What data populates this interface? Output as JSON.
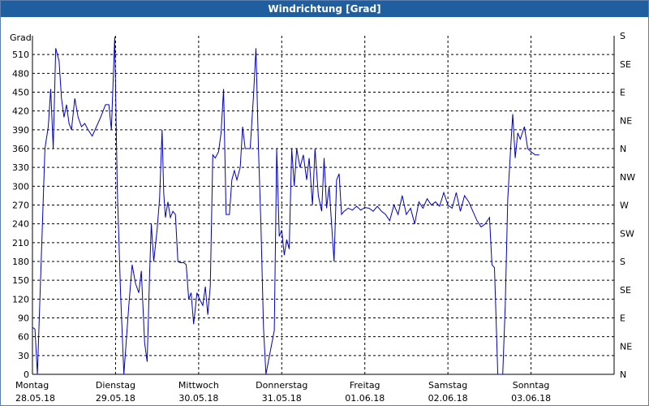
{
  "window": {
    "title": "Windrichtung [Grad]"
  },
  "chart_data": {
    "type": "line",
    "title": "Windrichtung [Grad]",
    "ylabel": "Grad",
    "ylim": [
      0,
      540
    ],
    "y_ticks": [
      0,
      30,
      60,
      90,
      120,
      150,
      180,
      210,
      240,
      270,
      300,
      330,
      360,
      390,
      420,
      450,
      480,
      510
    ],
    "y_tick_labels": [
      "0",
      "30",
      "60",
      "90",
      "120",
      "150",
      "180",
      "210",
      "240",
      "270",
      "300",
      "330",
      "360",
      "390",
      "420",
      "450",
      "480",
      "510"
    ],
    "right_axis_labels": [
      "N",
      "NE",
      "E",
      "SE",
      "S",
      "SW",
      "W",
      "NW",
      "N",
      "NE",
      "E",
      "SE",
      "S"
    ],
    "x_day_labels": [
      {
        "day": "Montag",
        "date": "28.05.18"
      },
      {
        "day": "Dienstag",
        "date": "29.05.18"
      },
      {
        "day": "Mittwoch",
        "date": "30.05.18"
      },
      {
        "day": "Donnerstag",
        "date": "31.05.18"
      },
      {
        "day": "Freitag",
        "date": "01.06.18"
      },
      {
        "day": "Samstag",
        "date": "02.06.18"
      },
      {
        "day": "Sonntag",
        "date": "03.06.18"
      }
    ],
    "xlim_days": [
      0,
      7
    ],
    "grid": true,
    "series": [
      {
        "color": "#0000c0",
        "points": [
          [
            0.0,
            75
          ],
          [
            0.03,
            72
          ],
          [
            0.06,
            0
          ],
          [
            0.15,
            360
          ],
          [
            0.19,
            395
          ],
          [
            0.22,
            455
          ],
          [
            0.25,
            360
          ],
          [
            0.28,
            520
          ],
          [
            0.32,
            500
          ],
          [
            0.35,
            440
          ],
          [
            0.38,
            410
          ],
          [
            0.41,
            430
          ],
          [
            0.44,
            400
          ],
          [
            0.47,
            390
          ],
          [
            0.51,
            440
          ],
          [
            0.55,
            410
          ],
          [
            0.59,
            395
          ],
          [
            0.63,
            400
          ],
          [
            0.67,
            390
          ],
          [
            0.72,
            380
          ],
          [
            0.77,
            395
          ],
          [
            0.82,
            410
          ],
          [
            0.88,
            430
          ],
          [
            0.92,
            430
          ],
          [
            0.95,
            390
          ],
          [
            0.99,
            538
          ],
          [
            1.02,
            300
          ],
          [
            1.06,
            130
          ],
          [
            1.1,
            0
          ],
          [
            1.16,
            110
          ],
          [
            1.2,
            175
          ],
          [
            1.24,
            145
          ],
          [
            1.28,
            130
          ],
          [
            1.31,
            165
          ],
          [
            1.35,
            50
          ],
          [
            1.38,
            20
          ],
          [
            1.41,
            160
          ],
          [
            1.43,
            240
          ],
          [
            1.46,
            180
          ],
          [
            1.5,
            230
          ],
          [
            1.53,
            280
          ],
          [
            1.56,
            390
          ],
          [
            1.58,
            290
          ],
          [
            1.6,
            250
          ],
          [
            1.63,
            275
          ],
          [
            1.66,
            250
          ],
          [
            1.69,
            260
          ],
          [
            1.72,
            255
          ],
          [
            1.75,
            180
          ],
          [
            1.78,
            178
          ],
          [
            1.82,
            178
          ],
          [
            1.85,
            175
          ],
          [
            1.88,
            120
          ],
          [
            1.91,
            130
          ],
          [
            1.94,
            80
          ],
          [
            1.98,
            130
          ],
          [
            2.01,
            120
          ],
          [
            2.05,
            110
          ],
          [
            2.08,
            140
          ],
          [
            2.11,
            95
          ],
          [
            2.14,
            140
          ],
          [
            2.17,
            350
          ],
          [
            2.2,
            345
          ],
          [
            2.24,
            355
          ],
          [
            2.27,
            385
          ],
          [
            2.3,
            455
          ],
          [
            2.33,
            255
          ],
          [
            2.37,
            255
          ],
          [
            2.4,
            310
          ],
          [
            2.43,
            325
          ],
          [
            2.46,
            310
          ],
          [
            2.5,
            330
          ],
          [
            2.53,
            395
          ],
          [
            2.56,
            360
          ],
          [
            2.59,
            360
          ],
          [
            2.62,
            360
          ],
          [
            2.66,
            445
          ],
          [
            2.69,
            520
          ],
          [
            2.72,
            360
          ],
          [
            2.75,
            235
          ],
          [
            2.78,
            75
          ],
          [
            2.81,
            0
          ],
          [
            2.91,
            70
          ],
          [
            2.94,
            360
          ],
          [
            2.97,
            220
          ],
          [
            3.0,
            230
          ],
          [
            3.03,
            190
          ],
          [
            3.06,
            215
          ],
          [
            3.09,
            200
          ],
          [
            3.12,
            360
          ],
          [
            3.15,
            300
          ],
          [
            3.18,
            360
          ],
          [
            3.22,
            330
          ],
          [
            3.26,
            350
          ],
          [
            3.3,
            310
          ],
          [
            3.33,
            345
          ],
          [
            3.37,
            270
          ],
          [
            3.4,
            360
          ],
          [
            3.44,
            285
          ],
          [
            3.48,
            260
          ],
          [
            3.51,
            345
          ],
          [
            3.54,
            265
          ],
          [
            3.57,
            300
          ],
          [
            3.6,
            240
          ],
          [
            3.63,
            180
          ],
          [
            3.66,
            310
          ],
          [
            3.69,
            320
          ],
          [
            3.72,
            255
          ],
          [
            3.75,
            260
          ],
          [
            3.8,
            265
          ],
          [
            3.85,
            262
          ],
          [
            3.9,
            268
          ],
          [
            3.95,
            262
          ],
          [
            4.0,
            266
          ],
          [
            4.05,
            265
          ],
          [
            4.1,
            260
          ],
          [
            4.15,
            268
          ],
          [
            4.2,
            260
          ],
          [
            4.25,
            255
          ],
          [
            4.3,
            245
          ],
          [
            4.35,
            270
          ],
          [
            4.4,
            255
          ],
          [
            4.45,
            285
          ],
          [
            4.5,
            255
          ],
          [
            4.55,
            265
          ],
          [
            4.6,
            240
          ],
          [
            4.65,
            275
          ],
          [
            4.7,
            265
          ],
          [
            4.75,
            280
          ],
          [
            4.8,
            270
          ],
          [
            4.85,
            275
          ],
          [
            4.9,
            268
          ],
          [
            4.95,
            290
          ],
          [
            5.0,
            270
          ],
          [
            5.05,
            265
          ],
          [
            5.1,
            290
          ],
          [
            5.15,
            260
          ],
          [
            5.2,
            285
          ],
          [
            5.25,
            275
          ],
          [
            5.3,
            260
          ],
          [
            5.35,
            245
          ],
          [
            5.4,
            235
          ],
          [
            5.45,
            240
          ],
          [
            5.5,
            250
          ],
          [
            5.53,
            175
          ],
          [
            5.56,
            170
          ],
          [
            5.58,
            85
          ],
          [
            5.6,
            0
          ],
          [
            5.66,
            0
          ],
          [
            5.69,
            110
          ],
          [
            5.72,
            280
          ],
          [
            5.75,
            350
          ],
          [
            5.78,
            415
          ],
          [
            5.81,
            345
          ],
          [
            5.84,
            385
          ],
          [
            5.87,
            375
          ],
          [
            5.92,
            395
          ],
          [
            5.96,
            360
          ],
          [
            6.0,
            355
          ],
          [
            6.05,
            350
          ],
          [
            6.1,
            350
          ]
        ]
      }
    ]
  }
}
